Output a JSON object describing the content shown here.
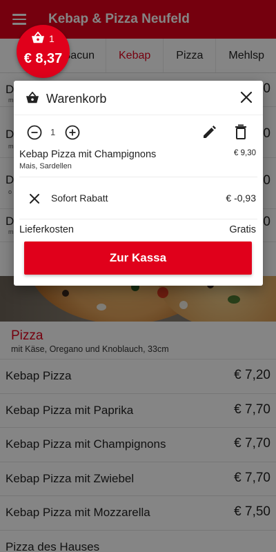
{
  "app": {
    "title": "Kebap & Pizza Neufeld"
  },
  "tabs": [
    {
      "label": "Bacun"
    },
    {
      "label": "Kebap"
    },
    {
      "label": "Pizza"
    },
    {
      "label": "Mehlsp"
    }
  ],
  "background_rows": [
    {
      "line1": "D",
      "line2": "m",
      "price": "0"
    },
    {
      "line1": "D",
      "line2": "m",
      "price": "0"
    },
    {
      "line1": "D",
      "line2": "o K",
      "price": "0"
    },
    {
      "line1": "D",
      "line2": "m",
      "price": "0"
    }
  ],
  "section": {
    "title": "Pizza",
    "description": "mit Käse, Oregano und Knoblauch, 33cm"
  },
  "menu_items": [
    {
      "name": "Kebap Pizza",
      "price": "€ 7,20"
    },
    {
      "name": "Kebap Pizza mit Paprika",
      "price": "€ 7,70"
    },
    {
      "name": "Kebap Pizza mit Champignons",
      "price": "€ 7,70"
    },
    {
      "name": "Kebap Pizza mit Zwiebel",
      "price": "€ 7,70"
    },
    {
      "name": "Kebap Pizza mit Mozzarella",
      "price": "€ 7,50"
    },
    {
      "name": "Pizza des Hauses",
      "price": ""
    }
  ],
  "cart_badge": {
    "count": "1",
    "total": "€ 8,37"
  },
  "cart": {
    "title": "Warenkorb",
    "quantity": "1",
    "item": {
      "name": "Kebap Pizza mit Champignons",
      "extras": "Mais, Sardellen",
      "price": "€ 9,30"
    },
    "discount": {
      "label": "Sofort Rabatt",
      "amount": "€ -0,93"
    },
    "delivery": {
      "label": "Lieferkosten",
      "value": "Gratis"
    },
    "checkout_label": "Zur Kassa"
  },
  "colors": {
    "accent": "#e0001b"
  },
  "icons": [
    "menu-icon",
    "basket-icon",
    "close-icon",
    "minus-icon",
    "plus-icon",
    "edit-icon",
    "delete-icon"
  ]
}
